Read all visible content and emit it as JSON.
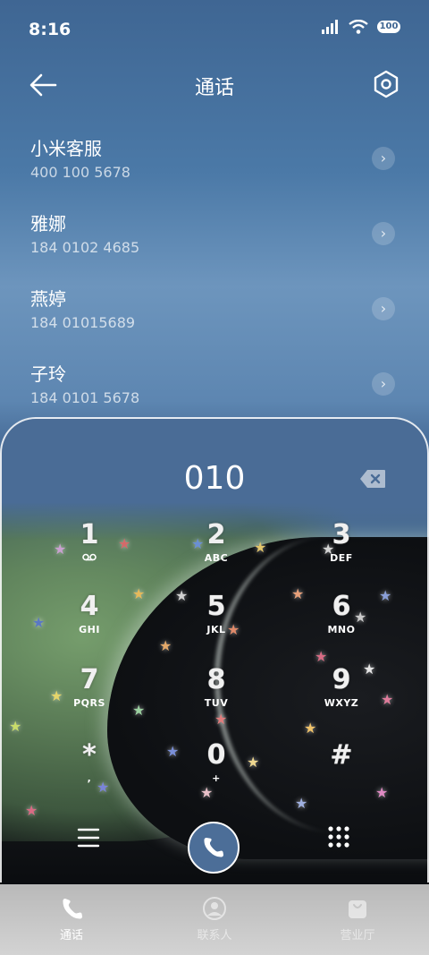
{
  "status_bar": {
    "time": "8:16",
    "battery": "100"
  },
  "header": {
    "title": "通话"
  },
  "contacts": [
    {
      "name": "小米客服",
      "number": "400 100 5678"
    },
    {
      "name": "雅娜",
      "number": "184 0102 4685"
    },
    {
      "name": "燕婷",
      "number": "184 01015689"
    },
    {
      "name": "子玲",
      "number": "184 0101 5678"
    }
  ],
  "dialer": {
    "entered_number": "010",
    "keys": [
      {
        "digit": "1",
        "letters": ""
      },
      {
        "digit": "2",
        "letters": "ABC"
      },
      {
        "digit": "3",
        "letters": "DEF"
      },
      {
        "digit": "4",
        "letters": "GHI"
      },
      {
        "digit": "5",
        "letters": "JKL"
      },
      {
        "digit": "6",
        "letters": "MNO"
      },
      {
        "digit": "7",
        "letters": "PQRS"
      },
      {
        "digit": "8",
        "letters": "TUV"
      },
      {
        "digit": "9",
        "letters": "WXYZ"
      },
      {
        "digit": "*",
        "letters": ","
      },
      {
        "digit": "0",
        "letters": "+"
      },
      {
        "digit": "#",
        "letters": ""
      }
    ]
  },
  "tabs": [
    {
      "label": "通话",
      "icon": "phone-icon",
      "active": true
    },
    {
      "label": "联系人",
      "icon": "person-icon",
      "active": false
    },
    {
      "label": "营业厅",
      "icon": "bag-icon",
      "active": false
    }
  ],
  "colors": {
    "accent": "#4c6e98",
    "tabbar": "#c4c4c4"
  }
}
